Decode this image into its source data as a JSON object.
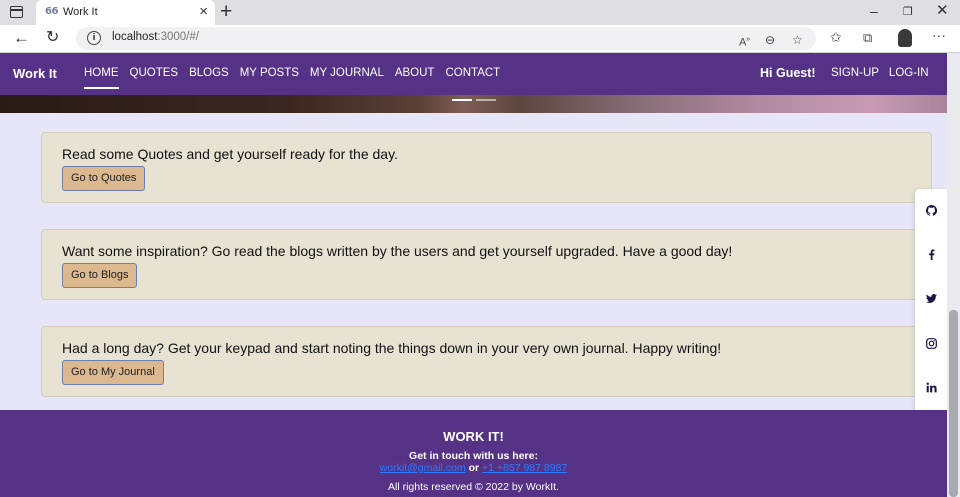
{
  "browser": {
    "tab_title": "Work It",
    "tab_favicon": "66",
    "url_host": "localhost",
    "url_path": ":3000/#/",
    "icons": [
      "back-arrow-icon",
      "refresh-icon",
      "info-icon",
      "read-aloud-icon",
      "zoom-icon",
      "add-favorite-icon",
      "favorites-icon",
      "collections-icon",
      "profile-icon",
      "more-icon"
    ]
  },
  "nav": {
    "brand": "Work It",
    "links": [
      "HOME",
      "QUOTES",
      "BLOGS",
      "MY POSTS",
      "MY JOURNAL",
      "ABOUT",
      "CONTACT"
    ],
    "active": "HOME",
    "greeting": "Hi Guest!",
    "signup": "SIGN-UP",
    "login": "LOG-IN"
  },
  "hero": {
    "indicators": 2,
    "active_indicator": 1
  },
  "cards": [
    {
      "text": "Read some Quotes and get yourself ready for the day.",
      "button": "Go to Quotes"
    },
    {
      "text": "Want some inspiration? Go read the blogs written by the users and get yourself upgraded. Have a good day!",
      "button": "Go to Blogs"
    },
    {
      "text": "Had a long day? Get your keypad and start noting the things down in your very own journal. Happy writing!",
      "button": "Go to My Journal"
    }
  ],
  "social": [
    "github-icon",
    "facebook-icon",
    "twitter-icon",
    "instagram-icon",
    "linkedin-icon"
  ],
  "footer": {
    "title": "WORK IT!",
    "touch": "Get in touch with us here:",
    "email": "workit@gmail.com",
    "or": "or",
    "phone": "+1 +857 987 8987",
    "rights": "All rights reserved © 2022 by WorkIt."
  },
  "colors": {
    "nav_bg": "#553285",
    "page_bg": "#e6e6f8",
    "card_bg": "#e7e2d2",
    "button_bg": "#dcb88f",
    "link": "#2b7bff"
  }
}
